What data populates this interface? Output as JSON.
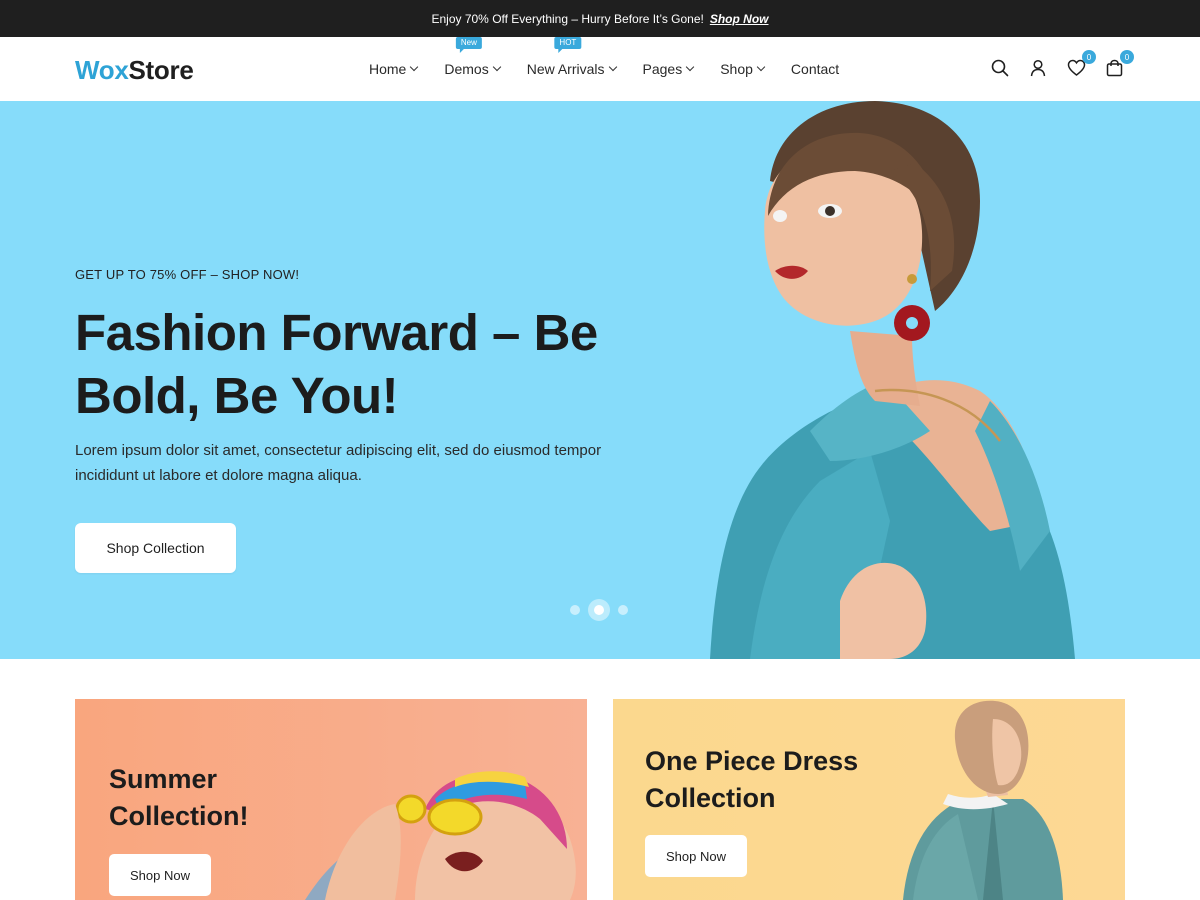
{
  "announcement": {
    "text": "Enjoy 70% Off Everything – Hurry Before It’s Gone!",
    "link": "Shop Now"
  },
  "logo": {
    "part1": "Wox",
    "part2": "Store"
  },
  "nav": {
    "items": [
      {
        "label": "Home",
        "badge": ""
      },
      {
        "label": "Demos",
        "badge": "New"
      },
      {
        "label": "New Arrivals",
        "badge": "HOT"
      },
      {
        "label": "Pages",
        "badge": ""
      },
      {
        "label": "Shop",
        "badge": ""
      },
      {
        "label": "Contact",
        "badge": ""
      }
    ]
  },
  "header_icons": {
    "wishlist_count": "0",
    "cart_count": "0",
    "icon_names": [
      "search-icon",
      "user-icon",
      "heart-icon",
      "bag-icon"
    ]
  },
  "hero": {
    "kicker": "GET UP TO 75% OFF – SHOP NOW!",
    "title": "Fashion Forward – Be Bold, Be You!",
    "text": "Lorem ipsum dolor sit amet, consectetur adipiscing elit, sed do eiusmod tempor incididunt ut labore et dolore magna aliqua.",
    "button": "Shop Collection",
    "slides": 3,
    "active_slide": 2
  },
  "banners": [
    {
      "title": "Summer Collection!",
      "button": "Shop Now"
    },
    {
      "title": "One Piece Dress Collection",
      "button": "Shop Now"
    }
  ],
  "colors": {
    "accent": "#2ea3d6",
    "topbar": "#1f1f1f",
    "hero_bg": "#86dcfa",
    "banner_left": "#f9a67e",
    "banner_right": "#fbd88e"
  }
}
